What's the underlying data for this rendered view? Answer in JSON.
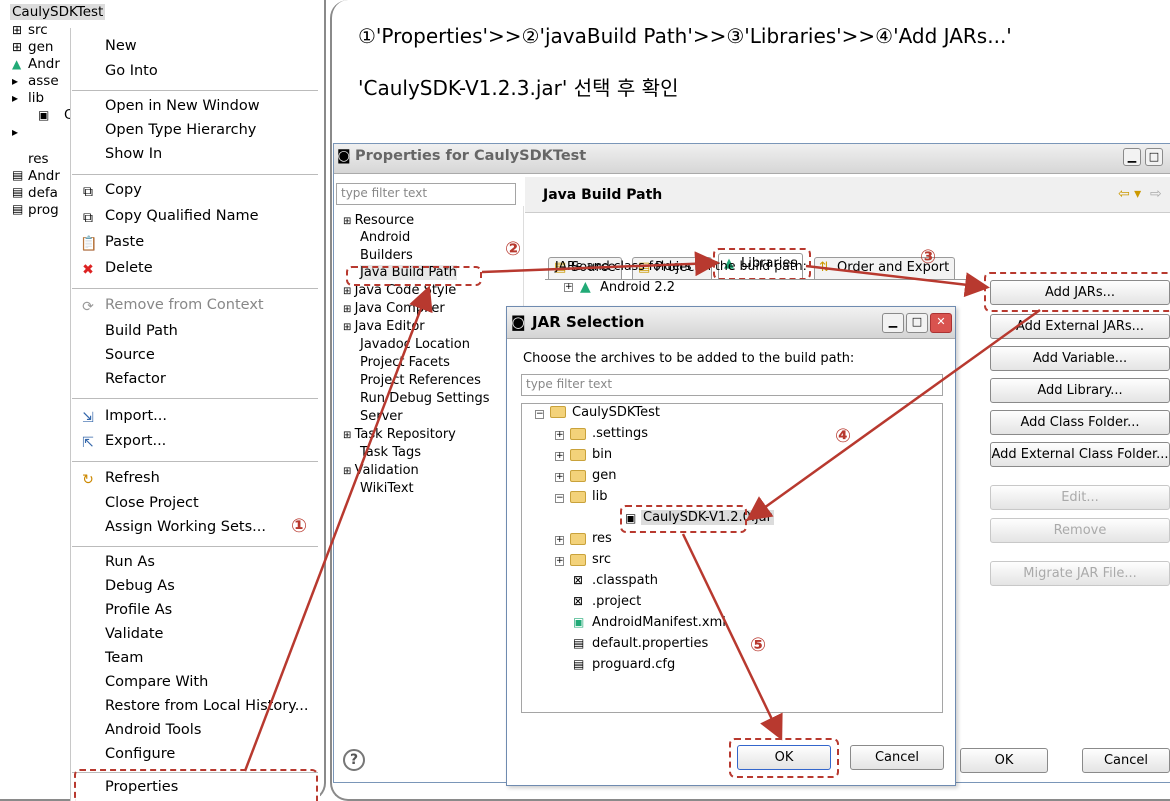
{
  "context_menu": {
    "project_root": "CaulySDKTest",
    "tree": [
      "src",
      "gen",
      "Andr",
      "asse",
      "lib",
      "O",
      "res",
      "Andr",
      "defa",
      "prog"
    ],
    "items": [
      "New",
      "Go Into",
      "Open in New Window",
      "Open Type Hierarchy",
      "Show In",
      "Copy",
      "Copy Qualified Name",
      "Paste",
      "Delete",
      "Remove from Context",
      "Build Path",
      "Source",
      "Refactor",
      "Import...",
      "Export...",
      "Refresh",
      "Close Project",
      "Assign Working Sets...",
      "Run As",
      "Debug As",
      "Profile As",
      "Validate",
      "Team",
      "Compare With",
      "Restore from Local History...",
      "Android Tools",
      "Configure",
      "Properties"
    ]
  },
  "instruction": {
    "line1": "①'Properties'>>②'javaBuild Path'>>③'Libraries'>>④'Add JARs...'",
    "line2": "'CaulySDK-V1.2.3.jar' 선택 후 확인"
  },
  "properties_dialog": {
    "title": "Properties for CaulySDKTest",
    "filter_placeholder": "type filter text",
    "section_title": "Java Build Path",
    "tree": [
      "Resource",
      "Android",
      "Builders",
      "Java Build Path",
      "Java Code Style",
      "Java Compiler",
      "Java Editor",
      "Javadoc Location",
      "Project Facets",
      "Project References",
      "Run/Debug Settings",
      "Server",
      "Task Repository",
      "Task Tags",
      "Validation",
      "WikiText"
    ],
    "tabs": [
      "Source",
      "Projects",
      "Libraries",
      "Order and Export"
    ],
    "jar_label": "JARs and class folders on the build path:",
    "library_entry": "Android 2.2",
    "buttons": [
      "Add JARs...",
      "Add External JARs...",
      "Add Variable...",
      "Add Library...",
      "Add Class Folder...",
      "Add External Class Folder...",
      "Edit...",
      "Remove",
      "Migrate JAR File..."
    ],
    "ok": "OK",
    "cancel": "Cancel",
    "help": "?"
  },
  "jar_dialog": {
    "title": "JAR Selection",
    "prompt": "Choose the archives to be added to the build path:",
    "filter_placeholder": "type filter text",
    "root": "CaulySDKTest",
    "items": [
      ".settings",
      "bin",
      "gen",
      "lib",
      "CaulySDK-V1.2.0.jar",
      "res",
      "src",
      ".classpath",
      ".project",
      "AndroidManifest.xml",
      "default.properties",
      "proguard.cfg"
    ],
    "ok": "OK",
    "cancel": "Cancel"
  },
  "step_markers": [
    "①",
    "②",
    "③",
    "④",
    "⑤"
  ],
  "colors": {
    "annotation": "#b8392f",
    "selection": "#316ac5"
  }
}
